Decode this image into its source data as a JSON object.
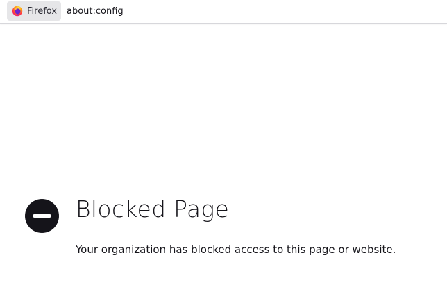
{
  "urlbar": {
    "identity_label": "Firefox",
    "identity_icon": "firefox-icon",
    "url": "about:config"
  },
  "blocked_page": {
    "icon": "blocked-icon",
    "title": "Blocked Page",
    "message": "Your organization has blocked access to this page or website."
  },
  "colors": {
    "text": "#15141a",
    "identity_background": "#e6e6e8",
    "blocked_icon": "#15141a"
  }
}
